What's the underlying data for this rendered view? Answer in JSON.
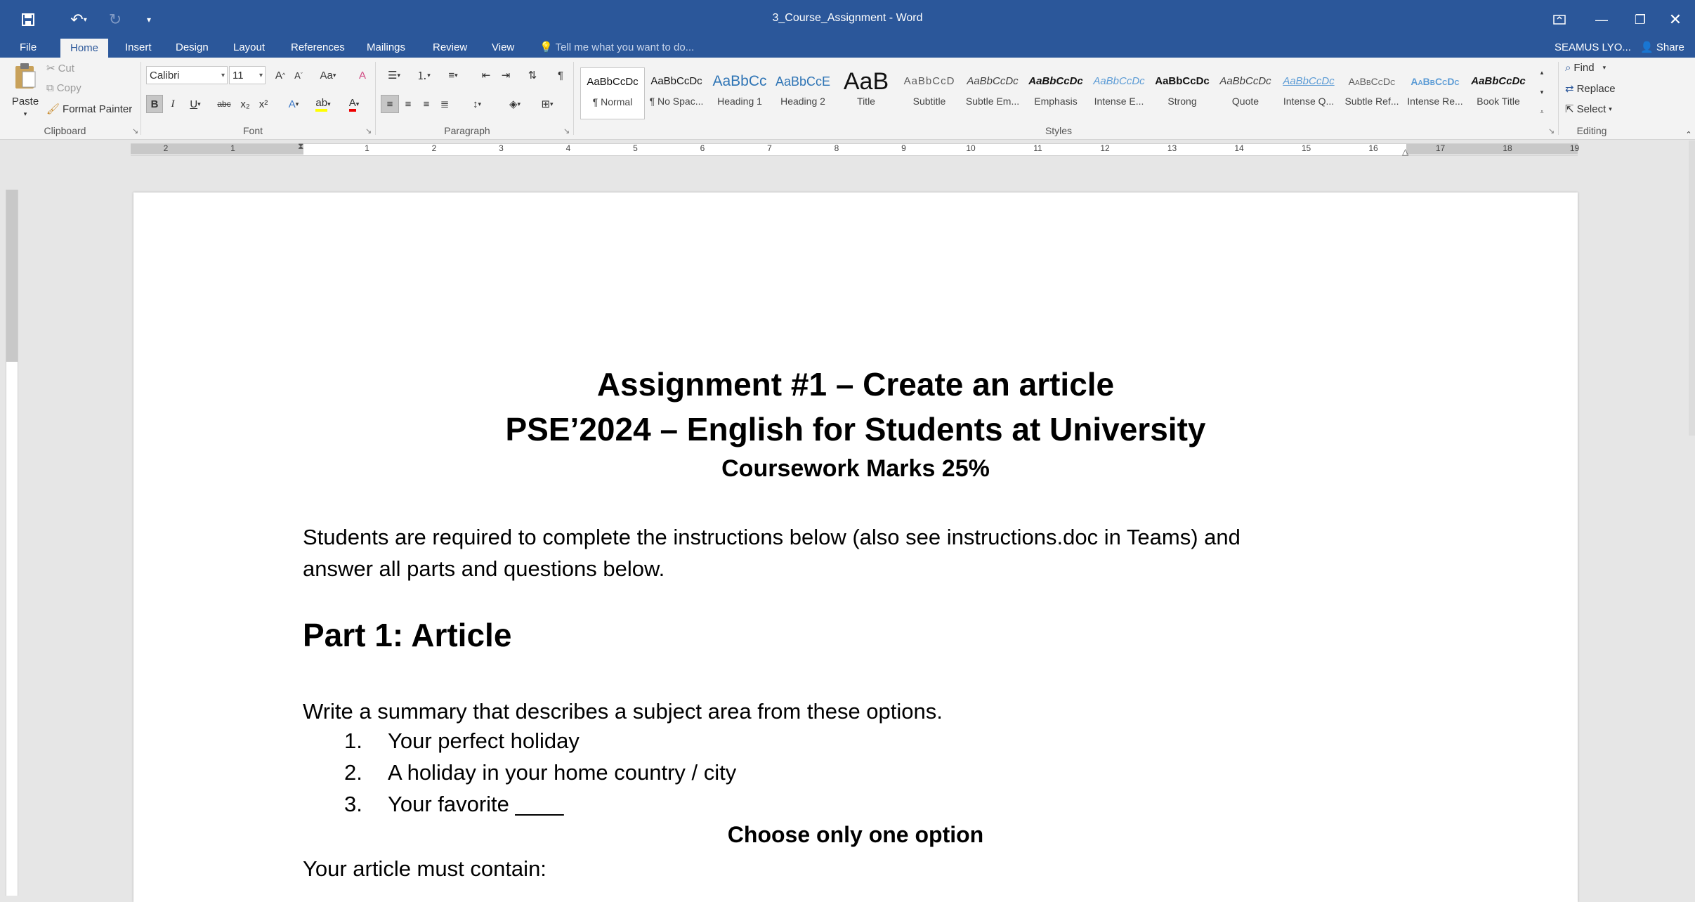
{
  "app": {
    "doc_title": "3_Course_Assignment - Word",
    "user": "SEAMUS LYO...",
    "share": "Share",
    "tell_me": "Tell me what you want to do..."
  },
  "tabs": [
    "File",
    "Home",
    "Insert",
    "Design",
    "Layout",
    "References",
    "Mailings",
    "Review",
    "View"
  ],
  "clipboard": {
    "paste": "Paste",
    "cut": "Cut",
    "copy": "Copy",
    "format_painter": "Format Painter",
    "label": "Clipboard"
  },
  "font": {
    "family": "Calibri",
    "size": "11",
    "label": "Font",
    "change_case": "Aa",
    "grow": "A",
    "shrink": "A",
    "bold": "B",
    "italic": "I",
    "underline": "U",
    "strike": "abc",
    "subscript": "x₂",
    "superscript": "x²"
  },
  "paragraph": {
    "label": "Paragraph"
  },
  "styles": {
    "label": "Styles",
    "items": [
      {
        "sample": "AaBbCcDc",
        "name": "¶ Normal"
      },
      {
        "sample": "AaBbCcDc",
        "name": "¶ No Spac..."
      },
      {
        "sample": "AaBbCc",
        "name": "Heading 1"
      },
      {
        "sample": "AaBbCcE",
        "name": "Heading 2"
      },
      {
        "sample": "AaB",
        "name": "Title"
      },
      {
        "sample": "AaBbCcD",
        "name": "Subtitle"
      },
      {
        "sample": "AaBbCcDc",
        "name": "Subtle Em..."
      },
      {
        "sample": "AaBbCcDc",
        "name": "Emphasis"
      },
      {
        "sample": "AaBbCcDc",
        "name": "Intense E..."
      },
      {
        "sample": "AaBbCcDc",
        "name": "Strong"
      },
      {
        "sample": "AaBbCcDc",
        "name": "Quote"
      },
      {
        "sample": "AaBbCcDc",
        "name": "Intense Q..."
      },
      {
        "sample": "AaBbCcDc",
        "name": "Subtle Ref..."
      },
      {
        "sample": "AaBbCcDc",
        "name": "Intense Re..."
      },
      {
        "sample": "AaBbCcDc",
        "name": "Book Title"
      }
    ]
  },
  "editing": {
    "label": "Editing",
    "find": "Find",
    "replace": "Replace",
    "select": "Select"
  },
  "ruler_numbers": [
    "2",
    "1",
    "1",
    "2",
    "3",
    "4",
    "5",
    "6",
    "7",
    "8",
    "9",
    "10",
    "11",
    "12",
    "13",
    "14",
    "15",
    "16",
    "17",
    "18",
    "19"
  ],
  "document": {
    "title": "Assignment #1 – Create an article",
    "subtitle": "PSE’2024 – English for Students at University",
    "marks": "Coursework Marks 25%",
    "intro_line1": "Students are required to complete the instructions below (also see instructions.doc in Teams) and",
    "intro_line2": "answer all parts and questions below.",
    "part1_heading": "Part 1: Article",
    "summary": "Write a summary that describes a subject area from these options.",
    "options": [
      {
        "num": "1.",
        "text": "Your perfect holiday"
      },
      {
        "num": "2.",
        "text": "A holiday in your home country / city"
      },
      {
        "num": "3.",
        "text": "Your favorite ____"
      }
    ],
    "choose": "Choose only one option",
    "must_contain": "Your article must contain:"
  },
  "colors": {
    "accent": "#2b579a",
    "ribbon": "#f3f3f3",
    "canvas": "#e6e6e6"
  }
}
